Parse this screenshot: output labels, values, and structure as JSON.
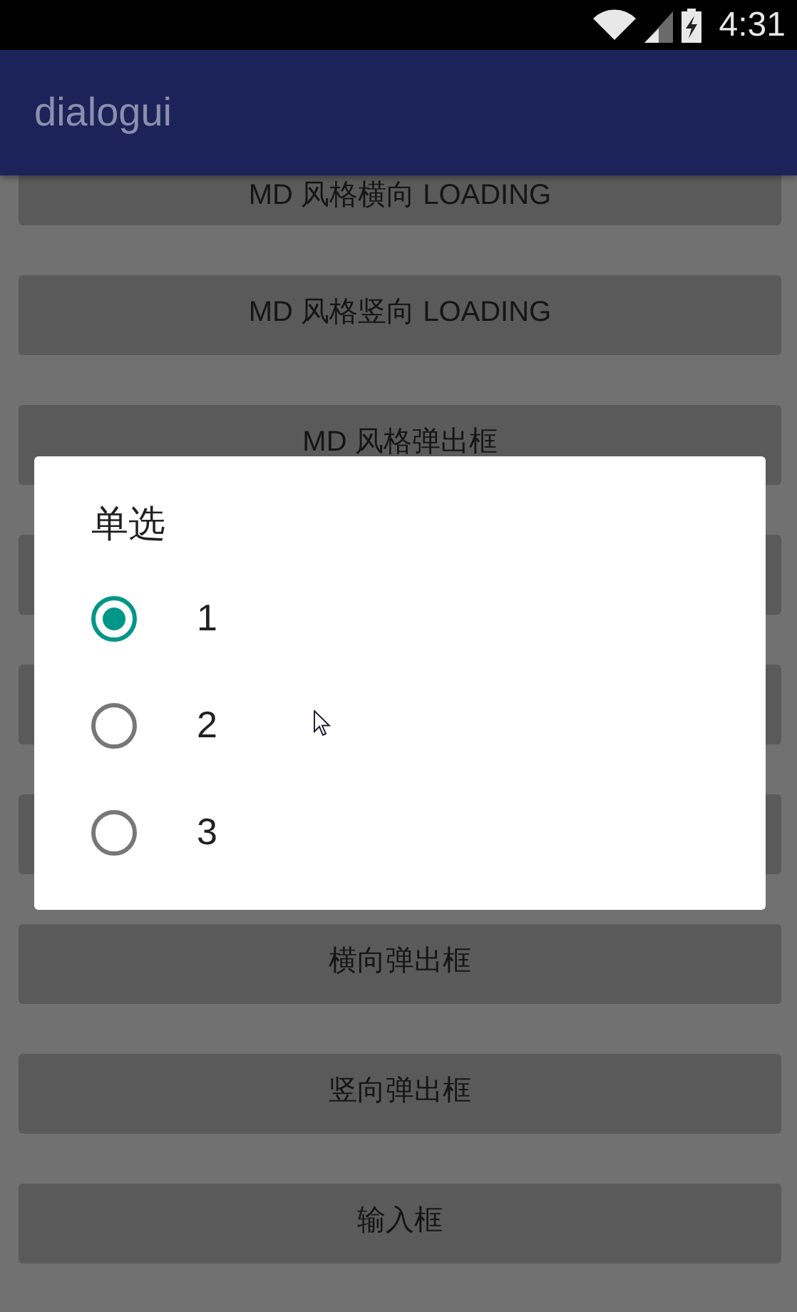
{
  "status_bar": {
    "time": "4:31"
  },
  "app_bar": {
    "title": "dialogui"
  },
  "buttons": [
    {
      "kind": "labeled",
      "label": "MD 风格横向 LOADING"
    },
    {
      "kind": "labeled",
      "label": "MD 风格竖向 LOADING"
    },
    {
      "kind": "labeled",
      "label": "MD 风格弹出框"
    },
    {
      "kind": "covered"
    },
    {
      "kind": "covered"
    },
    {
      "kind": "covered"
    },
    {
      "kind": "labeled",
      "label": "横向弹出框"
    },
    {
      "kind": "labeled",
      "label": "竖向弹出框"
    },
    {
      "kind": "labeled",
      "label": "输入框"
    }
  ],
  "dialog": {
    "title": "单选",
    "options": [
      {
        "label": "1",
        "selected": true
      },
      {
        "label": "2",
        "selected": false
      },
      {
        "label": "3",
        "selected": false
      }
    ]
  }
}
